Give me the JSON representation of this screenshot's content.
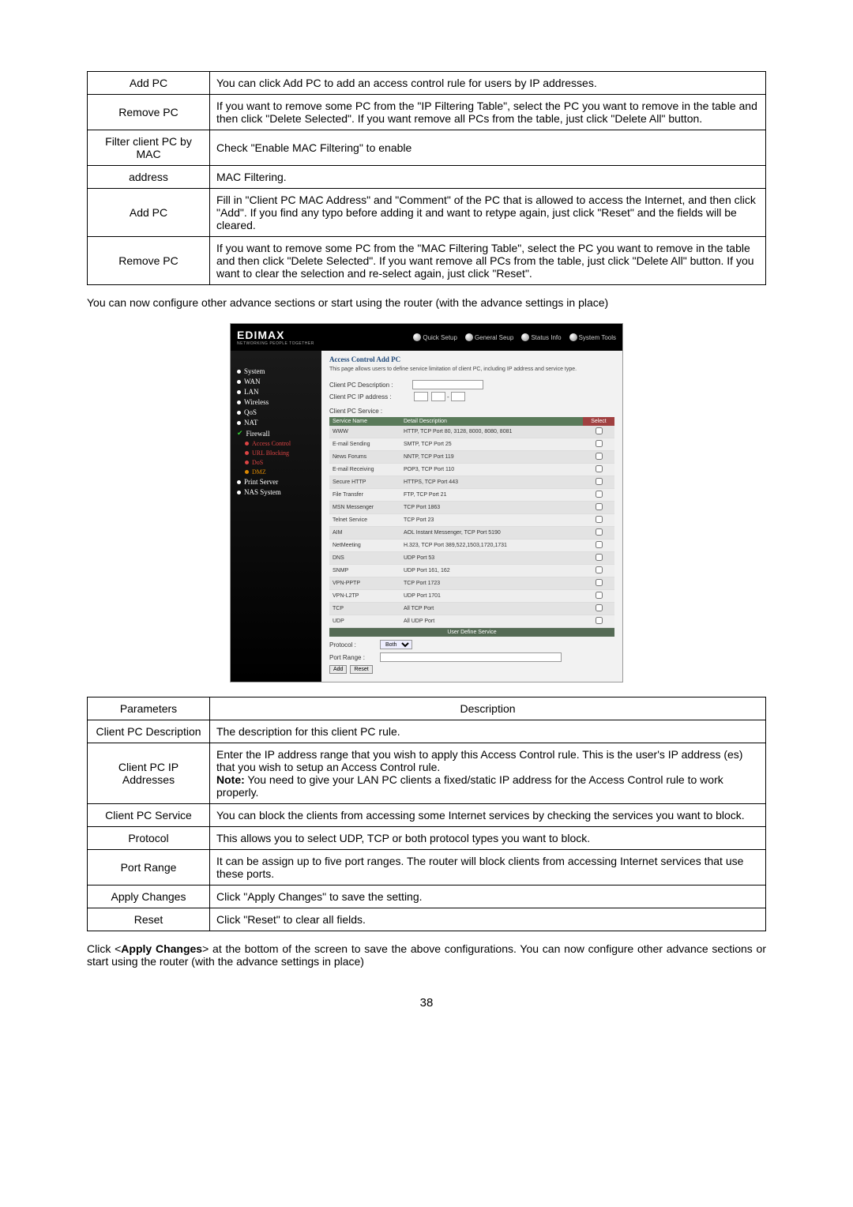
{
  "table_top": {
    "rows": [
      {
        "param": "Add PC",
        "desc": "You can click Add PC to add an access control rule for users by IP addresses."
      },
      {
        "param": "Remove PC",
        "desc": "If you want to remove some PC from the \"IP Filtering Table\", select the PC you want to remove in the table and then click \"Delete Selected\". If you want remove all PCs from the table, just click \"Delete All\" button."
      },
      {
        "param": "Filter client PC by MAC address",
        "desc": "Check \"Enable MAC Filtering\" to enable MAC Filtering.",
        "split": true,
        "desc_top": "Check \"Enable MAC Filtering\" to enable",
        "desc_bottom": "MAC Filtering."
      },
      {
        "param": "Add PC",
        "desc": "Fill in \"Client PC MAC Address\" and \"Comment\" of the PC that is allowed to access the Internet, and then click \"Add\". If you find any typo before adding it and want to retype again, just click \"Reset\" and the fields will be cleared."
      },
      {
        "param": "Remove PC",
        "desc": "If you want to remove some PC from the \"MAC Filtering Table\", select the PC you want to remove in the table and then click \"Delete Selected\". If you want remove all PCs from the table, just click \"Delete All\" button. If you want to clear the selection and re-select again, just click \"Reset\"."
      }
    ]
  },
  "intro_text": "You can now configure other advance sections or start using the router (with the advance settings in place)",
  "screenshot": {
    "logo": "EDIMAX",
    "logo_sub": "NETWORKING PEOPLE TOGETHER",
    "nav": [
      "Quick Setup",
      "General Seup",
      "Status Info",
      "System Tools"
    ],
    "sidebar": {
      "items": [
        "System",
        "WAN",
        "LAN",
        "Wireless",
        "QoS",
        "NAT"
      ],
      "firewall": "Firewall",
      "subs": [
        {
          "label": "Access Control",
          "cls": "red"
        },
        {
          "label": "URL Blocking",
          "cls": "red"
        },
        {
          "label": "DoS",
          "cls": "red"
        },
        {
          "label": "DMZ",
          "cls": "orange"
        }
      ],
      "after": [
        "Print Server",
        "NAS System"
      ]
    },
    "main": {
      "title": "Access Control Add PC",
      "desc": "This page allows users to define service limitation of client PC, including IP address and service type.",
      "field1_label": "Client PC Description :",
      "field2_label": "Client PC IP address :",
      "field3_label": "Client PC Service :",
      "svc_headers": {
        "name": "Service Name",
        "detail": "Detail Description",
        "sel": "Select"
      },
      "services": [
        {
          "name": "WWW",
          "detail": "HTTP, TCP Port 80, 3128, 8000, 8080, 8081"
        },
        {
          "name": "E-mail Sending",
          "detail": "SMTP, TCP Port 25"
        },
        {
          "name": "News Forums",
          "detail": "NNTP, TCP Port 119"
        },
        {
          "name": "E-mail Receiving",
          "detail": "POP3, TCP Port 110"
        },
        {
          "name": "Secure HTTP",
          "detail": "HTTPS, TCP Port 443"
        },
        {
          "name": "File Transfer",
          "detail": "FTP, TCP Port 21"
        },
        {
          "name": "MSN Messenger",
          "detail": "TCP Port 1863"
        },
        {
          "name": "Telnet Service",
          "detail": "TCP Port 23"
        },
        {
          "name": "AIM",
          "detail": "AOL Instant Messenger, TCP Port 5190"
        },
        {
          "name": "NetMeeting",
          "detail": "H.323, TCP Port 389,522,1503,1720,1731"
        },
        {
          "name": "DNS",
          "detail": "UDP Port 53"
        },
        {
          "name": "SNMP",
          "detail": "UDP Port 161, 162"
        },
        {
          "name": "VPN-PPTP",
          "detail": "TCP Port 1723"
        },
        {
          "name": "VPN-L2TP",
          "detail": "UDP Port 1701"
        },
        {
          "name": "TCP",
          "detail": "All TCP Port"
        },
        {
          "name": "UDP",
          "detail": "All UDP Port"
        }
      ],
      "user_define": "User Define Service",
      "protocol_label": "Protocol :",
      "protocol_value": "Both",
      "port_range_label": "Port Range :",
      "add_btn": "Add",
      "reset_btn": "Reset"
    }
  },
  "table_bottom": {
    "header_param": "Parameters",
    "header_desc": "Description",
    "rows": [
      {
        "param": "Client PC Description",
        "desc": "The description for this client PC rule."
      },
      {
        "param": "Client PC IP Addresses",
        "desc": "Enter the IP address range that you wish to apply this Access Control rule. This is the user's IP address (es) that you wish to setup an Access Control rule.\n Note: You need to give your LAN PC clients a fixed/static IP address for the Access Control rule to work properly.",
        "note_prefix": "Enter the IP address range that you wish to apply this Access Control rule. This is the user's IP address (es) that you wish to setup an Access Control rule.",
        "note_bold": "Note:",
        "note_rest": " You need to give your LAN PC clients a fixed/static IP address for the Access Control rule to work properly."
      },
      {
        "param": "Client PC Service",
        "desc": "You can block the clients from accessing some Internet services by checking the services you want to block."
      },
      {
        "param": "Protocol",
        "desc": "This allows you to select UDP, TCP or both protocol types you want to block."
      },
      {
        "param": "Port Range",
        "desc": "It can be assign up to five port ranges. The router will block clients from accessing Internet services that use these ports."
      },
      {
        "param": "Apply Changes",
        "desc": "Click \"Apply Changes\" to save the setting."
      },
      {
        "param": "Reset",
        "desc": "Click \"Reset\" to clear all fields."
      }
    ]
  },
  "footer": {
    "text_pre": "Click <",
    "text_bold": "Apply Changes",
    "text_post": "> at the bottom of the screen to save the above configurations. You can now configure other advance sections or start using the router (with the advance settings in place)"
  },
  "page_number": "38"
}
